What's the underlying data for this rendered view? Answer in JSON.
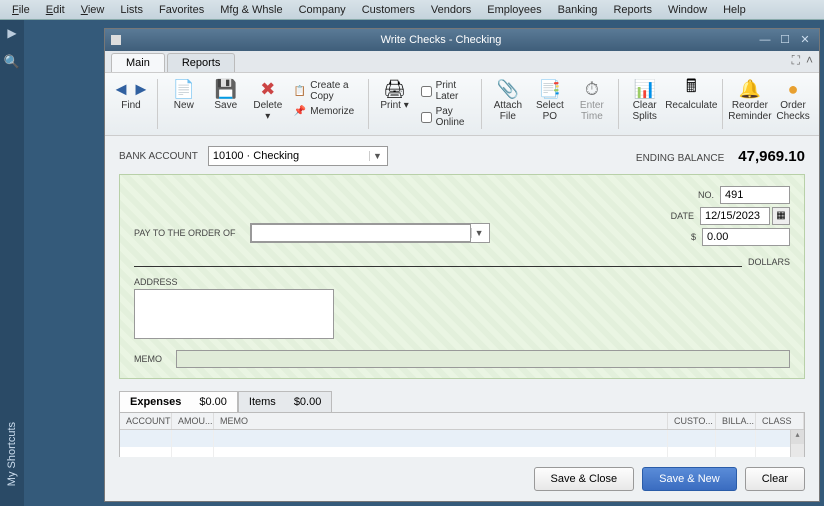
{
  "menubar": [
    "File",
    "Edit",
    "View",
    "Lists",
    "Favorites",
    "Mfg & Whsle",
    "Company",
    "Customers",
    "Vendors",
    "Employees",
    "Banking",
    "Reports",
    "Window",
    "Help"
  ],
  "leftrail": {
    "shortcuts": "My Shortcuts"
  },
  "window": {
    "title": "Write Checks - Checking",
    "tabs": {
      "main": "Main",
      "reports": "Reports"
    }
  },
  "toolbar": {
    "find": "Find",
    "new": "New",
    "save": "Save",
    "delete": "Delete",
    "create_copy": "Create a Copy",
    "memorize": "Memorize",
    "print": "Print",
    "print_later": "Print Later",
    "pay_online": "Pay Online",
    "attach": "Attach\nFile",
    "select_po": "Select\nPO",
    "enter_time": "Enter\nTime",
    "clear_splits": "Clear\nSplits",
    "recalculate": "Recalculate",
    "reorder": "Reorder\nReminder",
    "order_checks": "Order\nChecks"
  },
  "bank": {
    "label": "BANK ACCOUNT",
    "value": "10100 · Checking",
    "ending_label": "ENDING BALANCE",
    "ending_value": "47,969.10"
  },
  "check": {
    "no_label": "NO.",
    "no_value": "491",
    "date_label": "DATE",
    "date_value": "12/15/2023",
    "dollar_label": "$",
    "amount_value": "0.00",
    "pay_label": "PAY TO THE ORDER OF",
    "dollars_label": "DOLLARS",
    "address_label": "ADDRESS",
    "memo_label": "MEMO"
  },
  "subtabs": {
    "expenses_label": "Expenses",
    "expenses_amt": "$0.00",
    "items_label": "Items",
    "items_amt": "$0.00"
  },
  "grid": {
    "headers": [
      "ACCOUNT",
      "AMOU...",
      "MEMO",
      "CUSTO...",
      "BILLA...",
      "CLASS"
    ]
  },
  "footer": {
    "save_close": "Save & Close",
    "save_new": "Save & New",
    "clear": "Clear"
  }
}
